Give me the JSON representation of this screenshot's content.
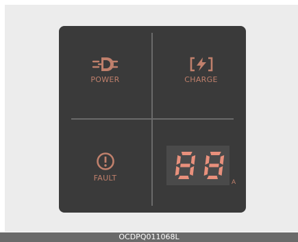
{
  "panel": {
    "power": {
      "icon": "power-plug-icon",
      "label": "POWER"
    },
    "charge": {
      "icon": "charge-bolt-icon",
      "label": "CHARGE"
    },
    "fault": {
      "icon": "exclamation-circle-icon",
      "label": "FAULT"
    },
    "display": {
      "value": "88",
      "unit": "A"
    }
  },
  "caption": "OCDPQ011068L",
  "colors": {
    "panel_bg": "#3a3a3a",
    "indicator": "#c0806c",
    "display_bg": "#4a4a4a",
    "segment": "#e8907c"
  }
}
